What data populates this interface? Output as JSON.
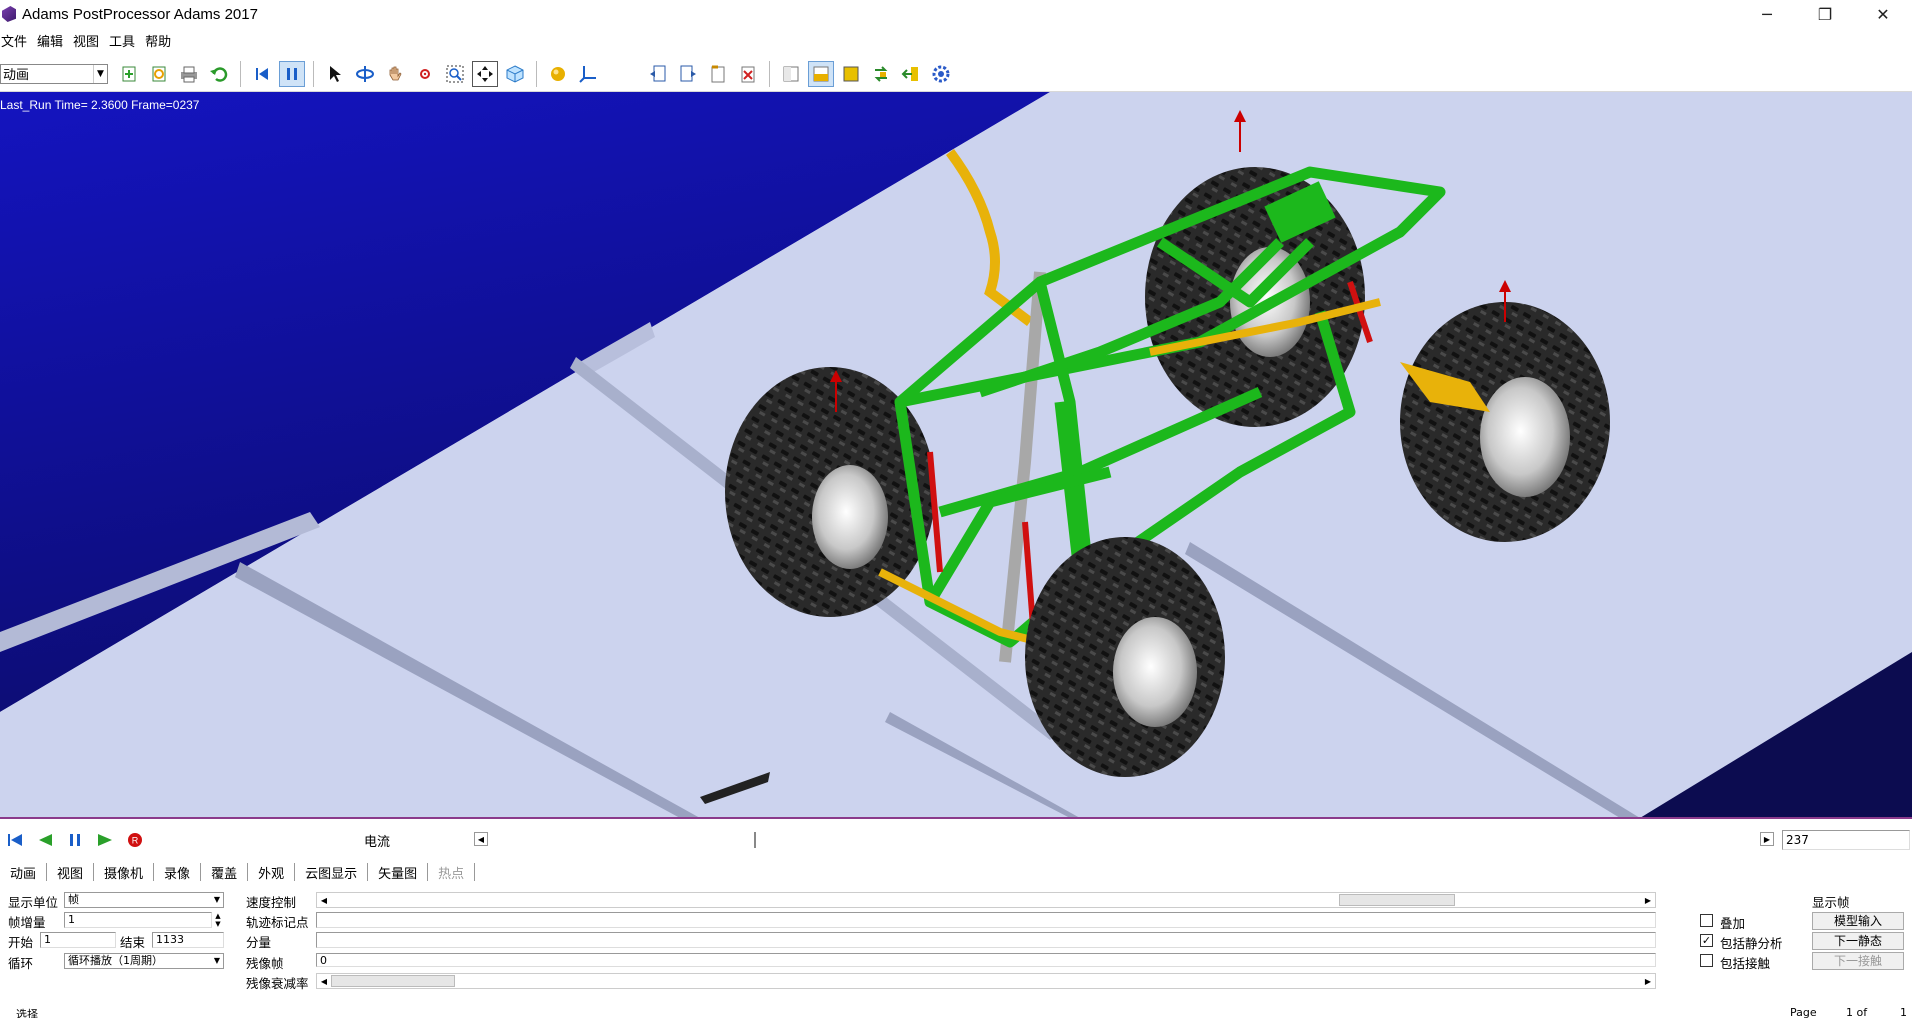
{
  "window": {
    "title": "Adams PostProcessor Adams 2017",
    "minimize": "─",
    "maximize": "❐",
    "close": "✕"
  },
  "menu": [
    "文件",
    "编辑",
    "视图",
    "工具",
    "帮助"
  ],
  "toolbar": {
    "mode_select": "动画"
  },
  "viewport": {
    "status": "Last_Run   Time=  2.3600  Frame=0237",
    "bg_top": "#1c1cc8",
    "floor": "#ccd3ee",
    "frame_green": "#1cb81c",
    "arm_gold": "#e8b20a"
  },
  "controls": {
    "signal_label": "电流",
    "frame_value": "237"
  },
  "tabs": [
    "动画",
    "视图",
    "摄像机",
    "录像",
    "覆盖",
    "外观",
    "云图显示",
    "矢量图",
    "热点"
  ],
  "panel": {
    "display_unit_label": "显示单位",
    "display_unit_value": "帧",
    "frame_inc_label": "帧增量",
    "frame_inc_value": "1",
    "start_label": "开始",
    "start_value": "1",
    "end_label": "结束",
    "end_value": "1133",
    "loop_label": "循环",
    "loop_value": "循环播放（1周期）",
    "speed_label": "速度控制",
    "trace_label": "轨迹标记点",
    "component_label": "分量",
    "ghost_label": "残像帧",
    "ghost_value": "0",
    "ghost_decay_label": "残像衰减率",
    "overlay_label": "叠加",
    "static_label": "包括静分析",
    "contact_label": "包括接触",
    "display_frame_label": "显示帧",
    "model_input_btn": "模型输入",
    "next_static_btn": "下一静态",
    "next_contact_btn": "下一接触"
  },
  "statusbar": {
    "left": "选择",
    "page": "Page",
    "page_of": "1 of",
    "page_total": "1"
  }
}
